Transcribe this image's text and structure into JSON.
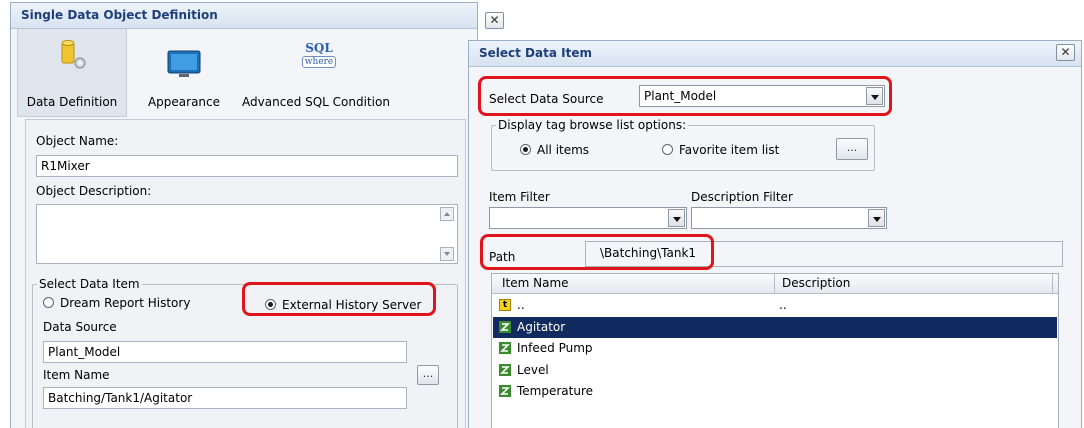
{
  "left_dialog": {
    "title": "Single Data Object Definition",
    "close_glyph": "✕",
    "toolbar": [
      {
        "label": "Data Definition",
        "icon": "database-gear-icon"
      },
      {
        "label": "Appearance",
        "icon": "monitor-icon"
      },
      {
        "label": "Advanced SQL Condition",
        "icon": "sql-where-icon",
        "icon_text_top": "SQL",
        "icon_text_bottom": "where"
      }
    ],
    "object_name_label": "Object Name:",
    "object_name_value": "R1Mixer",
    "object_description_label": "Object Description:",
    "object_description_value": "",
    "select_data_item": {
      "legend": "Select Data Item",
      "option_dream_report": "Dream Report History",
      "option_external": "External History Server",
      "selected": "External History Server",
      "data_source_label": "Data Source",
      "data_source_value": "Plant_Model",
      "item_name_label": "Item Name",
      "item_name_value": "Batching/Tank1/Agitator",
      "browse_label": "..."
    }
  },
  "right_dialog": {
    "title": "Select Data Item",
    "close_glyph": "✕",
    "select_data_source_label": "Select Data Source",
    "select_data_source_value": "Plant_Model",
    "display_options": {
      "legend": "Display tag browse list options:",
      "option_all": "All items",
      "option_favorite": "Favorite item list",
      "selected": "All items",
      "browse_label": "..."
    },
    "item_filter_label": "Item Filter",
    "item_filter_value": "",
    "description_filter_label": "Description Filter",
    "description_filter_value": "",
    "path_label": "Path",
    "path_value": "\\Batching\\Tank1",
    "list": {
      "columns": [
        "Item Name",
        "Description"
      ],
      "rows": [
        {
          "name": "..",
          "description": "..",
          "icon": "folder-up-icon",
          "selected": false
        },
        {
          "name": "Agitator",
          "description": "",
          "icon": "tag-icon",
          "selected": true
        },
        {
          "name": "Infeed Pump",
          "description": "",
          "icon": "tag-icon",
          "selected": false
        },
        {
          "name": "Level",
          "description": "",
          "icon": "tag-icon",
          "selected": false
        },
        {
          "name": "Temperature",
          "description": "",
          "icon": "tag-icon",
          "selected": false
        }
      ]
    }
  },
  "colors": {
    "title_text": "#1f3f7a",
    "highlight_frame": "#e0141b",
    "selected_row": "#112a60",
    "tag_icon_green": "#3a8a2e",
    "folder_up_yellow": "#f6d21a"
  }
}
